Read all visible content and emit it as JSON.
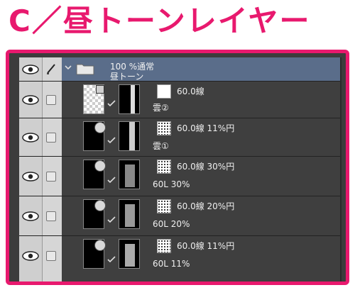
{
  "title": "C／昼トーンレイヤー",
  "folder": {
    "opacity_mode": "100 %通常",
    "name": "昼トーン"
  },
  "layers": [
    {
      "tone_info": "60.0線",
      "name": "雲②"
    },
    {
      "tone_info": "60.0線 11%円",
      "name": "雲①"
    },
    {
      "tone_info": "60.0線 30%円",
      "name": "60L 30%"
    },
    {
      "tone_info": "60.0線 20%円",
      "name": "60L 20%"
    },
    {
      "tone_info": "60.0線 11%円",
      "name": "60L 11%"
    }
  ],
  "colors": {
    "accent": "#e8196e",
    "folder_row": "#5a6d8a",
    "panel_bg": "#3c3c3c"
  },
  "icons": {
    "visibility": "eye-icon",
    "lock": "checkbox-icon",
    "pen": "pen-icon",
    "folder": "folder-icon",
    "expand": "chevron-down-icon",
    "tone": "halftone-icon"
  }
}
